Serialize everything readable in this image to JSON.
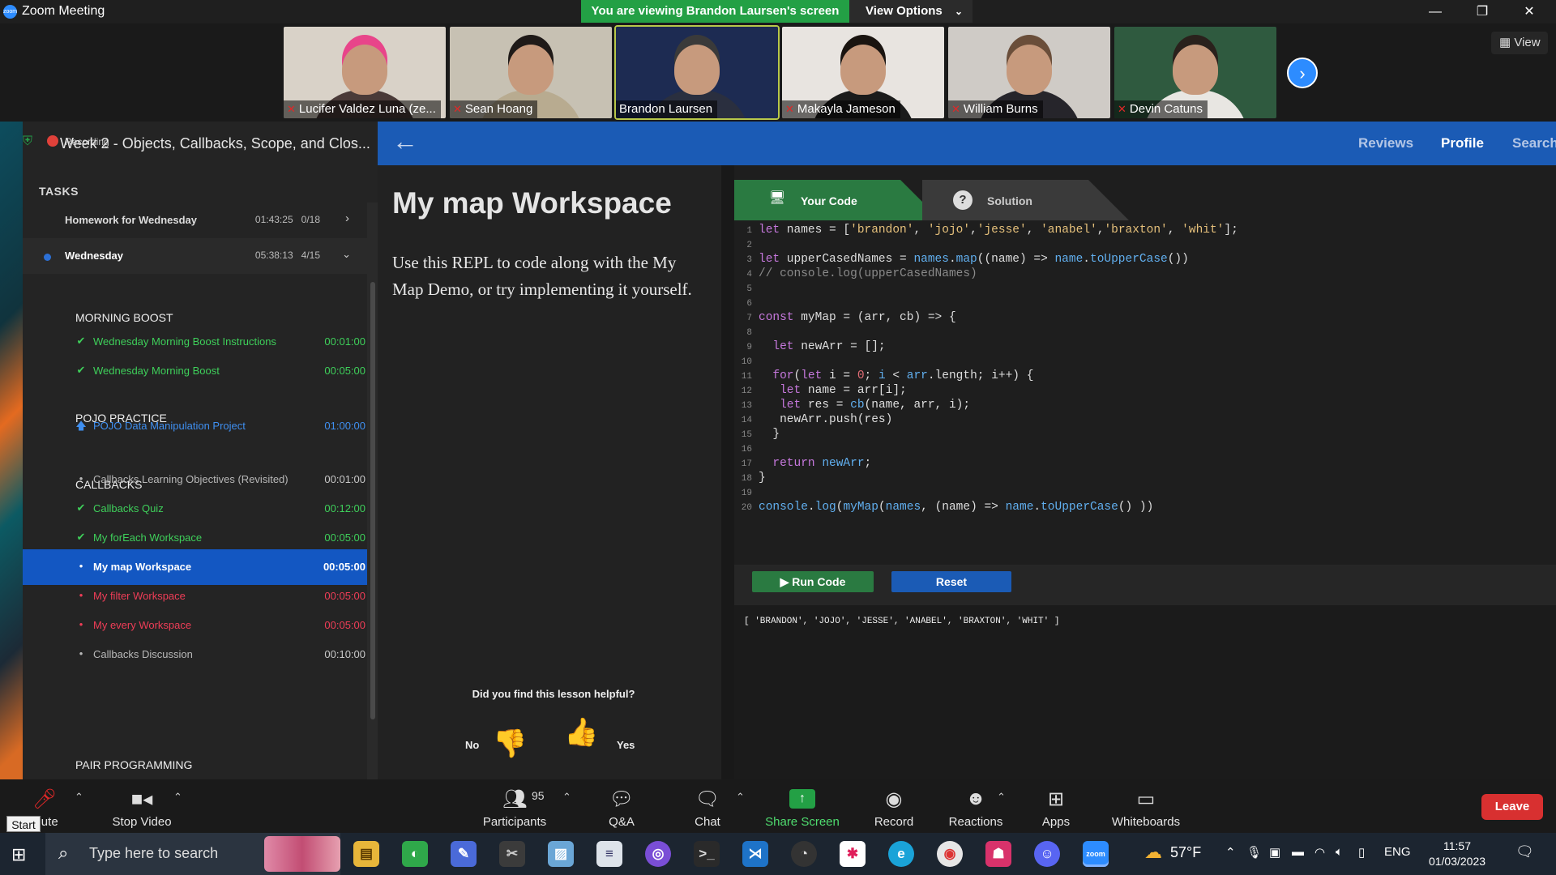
{
  "window": {
    "app_title": "Zoom Meeting",
    "viewing_banner": "You are viewing Brandon Laursen's screen",
    "view_options": "View Options",
    "view_button": "View"
  },
  "participants_strip": [
    {
      "name": "Lucifer Valdez Luna (ze...",
      "muted": true,
      "bg": "#d9d2c8",
      "shirt": "#4a3a38",
      "hair": "#e8458a"
    },
    {
      "name": "Sean Hoang",
      "muted": true,
      "bg": "#c7c1b3",
      "shirt": "#b8ab90",
      "hair": "#1f1a18"
    },
    {
      "name": "Brandon Laursen",
      "muted": false,
      "bg": "#1d2b52",
      "shirt": "#2a2f3f",
      "hair": "#3a3a3a"
    },
    {
      "name": "Makayla Jameson",
      "muted": true,
      "bg": "#e8e4e0",
      "shirt": "#1b1b1b",
      "hair": "#1a1410"
    },
    {
      "name": "William Burns",
      "muted": true,
      "bg": "#cfcbc6",
      "shirt": "#26252b",
      "hair": "#6a4e3a"
    },
    {
      "name": "Devin Catuns",
      "muted": true,
      "bg": "#2f5a3f",
      "shirt": "#e8e6e2",
      "hair": "#2a211c"
    }
  ],
  "sidebar": {
    "recording_label": "Recording",
    "course_title": "Week 2 - Objects, Callbacks, Scope, and Clos...",
    "tasks_label": "TASKS",
    "homework": {
      "label": "Homework for Wednesday",
      "time": "01:43:25",
      "progress": "0/18"
    },
    "wednesday": {
      "label": "Wednesday",
      "time": "05:38:13",
      "progress": "4/15"
    },
    "groups": [
      {
        "label": "MORNING BOOST"
      },
      {
        "label": "POJO PRACTICE"
      },
      {
        "label": "CALLBACKS"
      },
      {
        "label": "PAIR PROGRAMMING"
      }
    ],
    "items": [
      {
        "label": "Wednesday Morning Boost Instructions",
        "duration": "00:01:00",
        "status": "done",
        "icon": "check-icon"
      },
      {
        "label": "Wednesday Morning Boost",
        "duration": "00:05:00",
        "status": "done",
        "icon": "check-icon"
      },
      {
        "label": "POJO Data Manipulation Project",
        "duration": "01:00:00",
        "status": "submitted",
        "icon": "upload-arrow-icon"
      },
      {
        "label": "Callbacks Learning Objectives (Revisited)",
        "duration": "00:01:00",
        "status": "pending",
        "icon": "bullet-icon"
      },
      {
        "label": "Callbacks Quiz",
        "duration": "00:12:00",
        "status": "done",
        "icon": "check-icon"
      },
      {
        "label": "My forEach Workspace",
        "duration": "00:05:00",
        "status": "done",
        "icon": "check-icon"
      },
      {
        "label": "My map Workspace",
        "duration": "00:05:00",
        "status": "active",
        "icon": "bullet-icon"
      },
      {
        "label": "My filter Workspace",
        "duration": "00:05:00",
        "status": "todo",
        "icon": "bullet-icon"
      },
      {
        "label": "My every Workspace",
        "duration": "00:05:00",
        "status": "todo",
        "icon": "bullet-icon"
      },
      {
        "label": "Callbacks Discussion",
        "duration": "00:10:00",
        "status": "pending",
        "icon": "bullet-icon"
      }
    ]
  },
  "topnav": {
    "reviews": "Reviews",
    "profile": "Profile",
    "search": "Search"
  },
  "lesson": {
    "title": "My map Workspace",
    "description": "Use this REPL to code along with the My Map Demo, or try implementing it yourself.",
    "helpful_question": "Did you find this lesson helpful?",
    "no_label": "No",
    "yes_label": "Yes"
  },
  "editor": {
    "tab_your_code": "Your Code",
    "tab_solution": "Solution",
    "run_label": "▶ Run Code",
    "reset_label": "Reset",
    "output": "[ 'BRANDON', 'JOJO', 'JESSE', 'ANABEL', 'BRAXTON', 'WHIT' ]"
  },
  "toolbar": {
    "mute": "Mute",
    "start_tooltip": "Start",
    "stop_video": "Stop Video",
    "participants": "Participants",
    "participants_count": "95",
    "qa": "Q&A",
    "chat": "Chat",
    "share_screen": "Share Screen",
    "record": "Record",
    "reactions": "Reactions",
    "apps": "Apps",
    "whiteboards": "Whiteboards",
    "leave": "Leave"
  },
  "taskbar": {
    "search_placeholder": "Type here to search",
    "weather": "57°F",
    "language": "ENG",
    "time": "11:57",
    "date": "01/03/2023"
  },
  "colors": {
    "zoom_green": "#23a045",
    "platform_blue": "#1b5bb5",
    "done_green": "#3ecf5a",
    "submitted_blue": "#3f8ff0",
    "todo_red": "#ef3d57",
    "leave_red": "#d83030"
  }
}
